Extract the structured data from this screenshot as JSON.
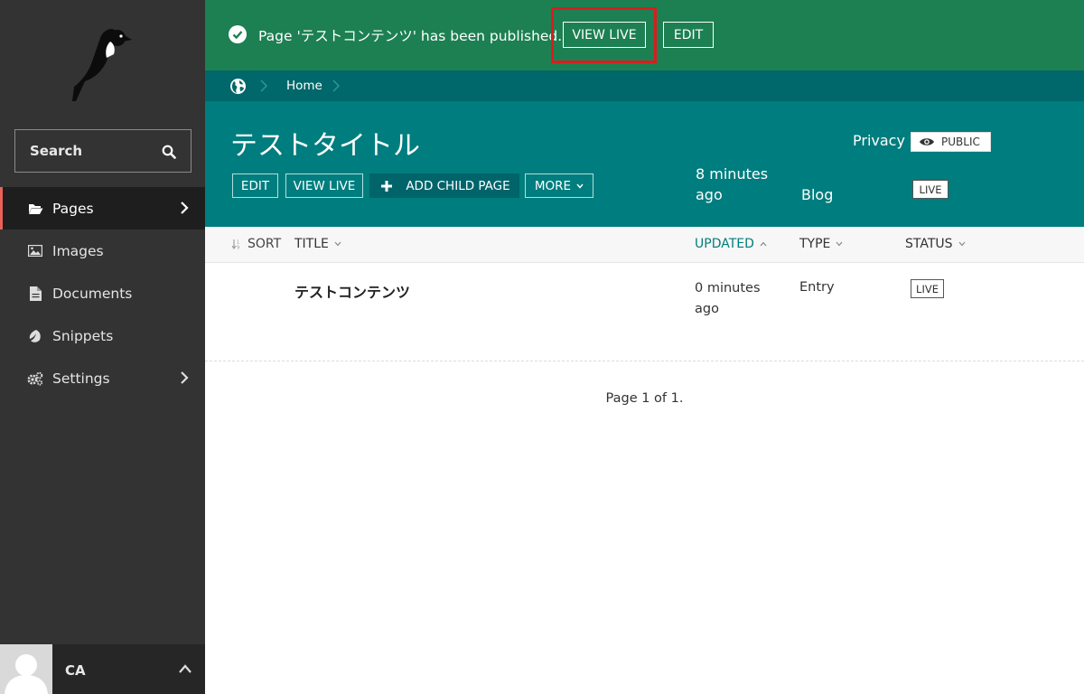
{
  "sidebar": {
    "search_placeholder": "Search",
    "items": [
      {
        "label": "Pages"
      },
      {
        "label": "Images"
      },
      {
        "label": "Documents"
      },
      {
        "label": "Snippets"
      },
      {
        "label": "Settings"
      }
    ],
    "user_initials": "CA"
  },
  "message": {
    "text": "Page 'テストコンテンツ' has been published.",
    "view_live_label": "VIEW LIVE",
    "edit_label": "EDIT"
  },
  "breadcrumb": {
    "home_label": "Home"
  },
  "header": {
    "title": "テストタイトル",
    "edit_label": "EDIT",
    "view_live_label": "VIEW LIVE",
    "add_child_label": "ADD CHILD PAGE",
    "more_label": "MORE",
    "updated": "8 minutes ago",
    "type": "Blog",
    "privacy_label": "Privacy",
    "privacy_value": "PUBLIC",
    "status": "LIVE"
  },
  "listing": {
    "columns": {
      "sort": "SORT",
      "title": "TITLE",
      "updated": "UPDATED",
      "type": "TYPE",
      "status": "STATUS"
    },
    "rows": [
      {
        "title": "テストコンテンツ",
        "updated": "0 minutes ago",
        "type": "Entry",
        "status": "LIVE"
      }
    ],
    "pagination": "Page 1 of 1."
  },
  "colors": {
    "sidebar_bg": "#333333",
    "success_bar": "#1d8052",
    "breadcrumb_bg": "#00676a",
    "header_bg": "#007d7e",
    "active_accent": "#e9605b",
    "highlight": "#d81e1e"
  }
}
